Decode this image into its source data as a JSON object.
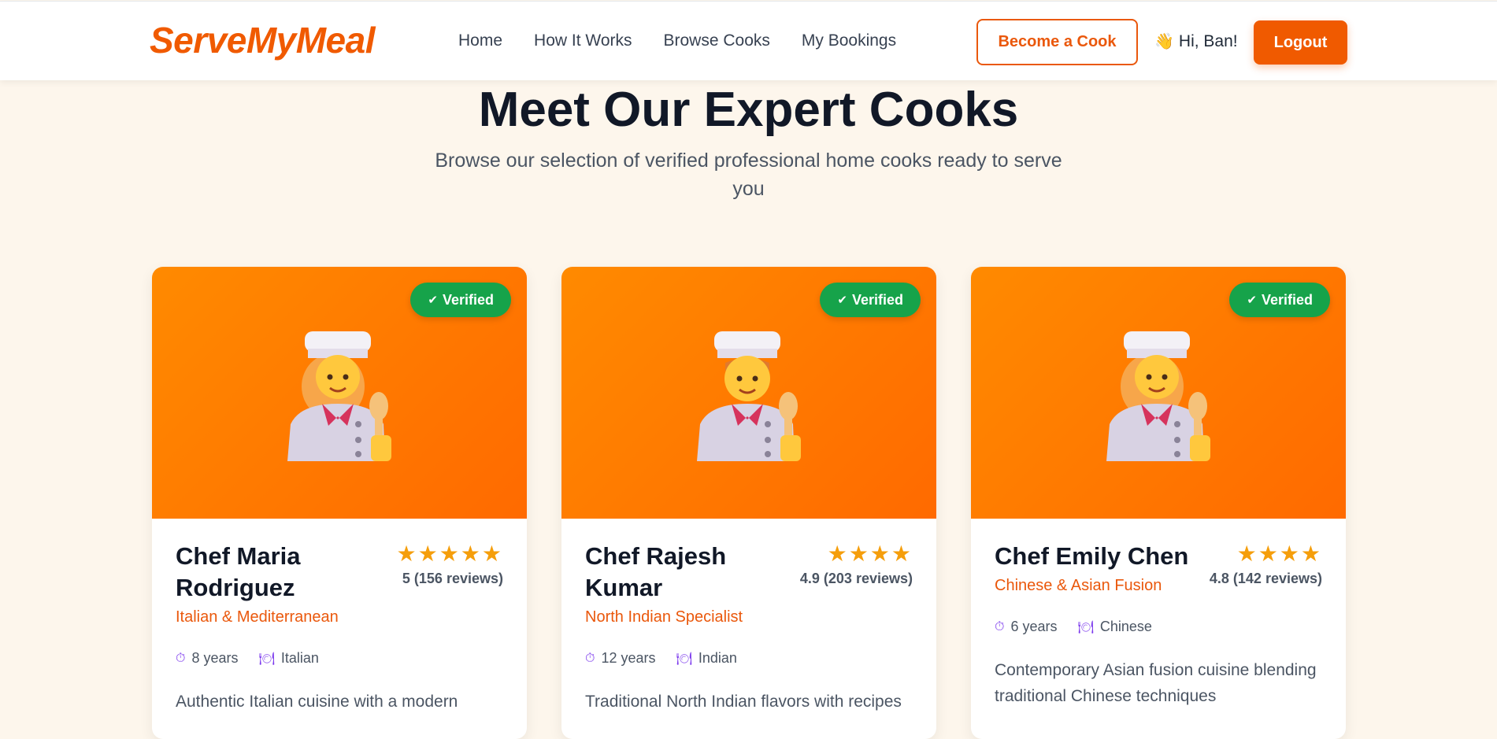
{
  "nav": {
    "logo": "ServeMyMeal",
    "links": [
      "Home",
      "How It Works",
      "Browse Cooks",
      "My Bookings"
    ],
    "become_cook": "Become a Cook",
    "greeting": "Hi, Ban!",
    "logout": "Logout"
  },
  "page": {
    "title": "Meet Our Expert Cooks",
    "subtitle": "Browse our selection of verified professional home cooks ready to serve you"
  },
  "cards": [
    {
      "badge": "Verified",
      "name": "Chef Maria Rodriguez",
      "specialty": "Italian & Mediterranean",
      "stars": "★★★★★",
      "rating_text": "5 (156 reviews)",
      "experience": "8 years",
      "cuisine": "Italian",
      "description": "Authentic Italian cuisine with a modern"
    },
    {
      "badge": "Verified",
      "name": "Chef Rajesh Kumar",
      "specialty": "North Indian Specialist",
      "stars": "★★★★",
      "rating_text": "4.9 (203 reviews)",
      "experience": "12 years",
      "cuisine": "Indian",
      "description": "Traditional North Indian flavors with recipes"
    },
    {
      "badge": "Verified",
      "name": "Chef Emily Chen",
      "specialty": "Chinese & Asian Fusion",
      "stars": "★★★★",
      "rating_text": "4.8 (142 reviews)",
      "experience": "6 years",
      "cuisine": "Chinese",
      "description": "Contemporary Asian fusion cuisine blending traditional Chinese techniques"
    }
  ],
  "colors": {
    "brand": "#f05a00",
    "verified": "#16a34a",
    "star": "#f59e0b",
    "card_gradient_start": "#ff8a00",
    "card_gradient_end": "#ff6a00",
    "background": "#fdf6ec"
  }
}
